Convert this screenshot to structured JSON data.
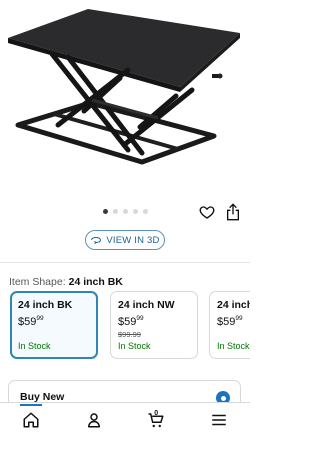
{
  "product": {
    "image_icon": "standing-desk-converter-image",
    "carousel_count": 5,
    "carousel_active": 0
  },
  "actions": {
    "wishlist_icon": "heart-icon",
    "share_icon": "share-icon",
    "view3d_label": "VIEW IN 3D",
    "view3d_icon": "3d-cube-icon"
  },
  "variant": {
    "label": "Item Shape:",
    "selected": "24 inch BK",
    "options": [
      {
        "name": "24 inch BK",
        "dollars": "$59",
        "cents": "99",
        "list_price": "",
        "stock": "In Stock",
        "selected": true
      },
      {
        "name": "24 inch NW",
        "dollars": "$59",
        "cents": "99",
        "list_price": "$99.99",
        "stock": "In Stock",
        "selected": false
      },
      {
        "name": "24 inch",
        "dollars": "$59",
        "cents": "99",
        "list_price": "",
        "stock": "In Stock",
        "selected": false
      }
    ]
  },
  "buy_box": {
    "title": "Buy New",
    "radio_selected": true
  },
  "nav": {
    "items": [
      "home-icon",
      "account-icon",
      "cart-icon",
      "menu-icon"
    ],
    "cart_count": "0"
  },
  "colors": {
    "link": "#1a6592",
    "accent": "#2f86b5",
    "in_stock": "#007600",
    "radio": "#1a74c4"
  }
}
